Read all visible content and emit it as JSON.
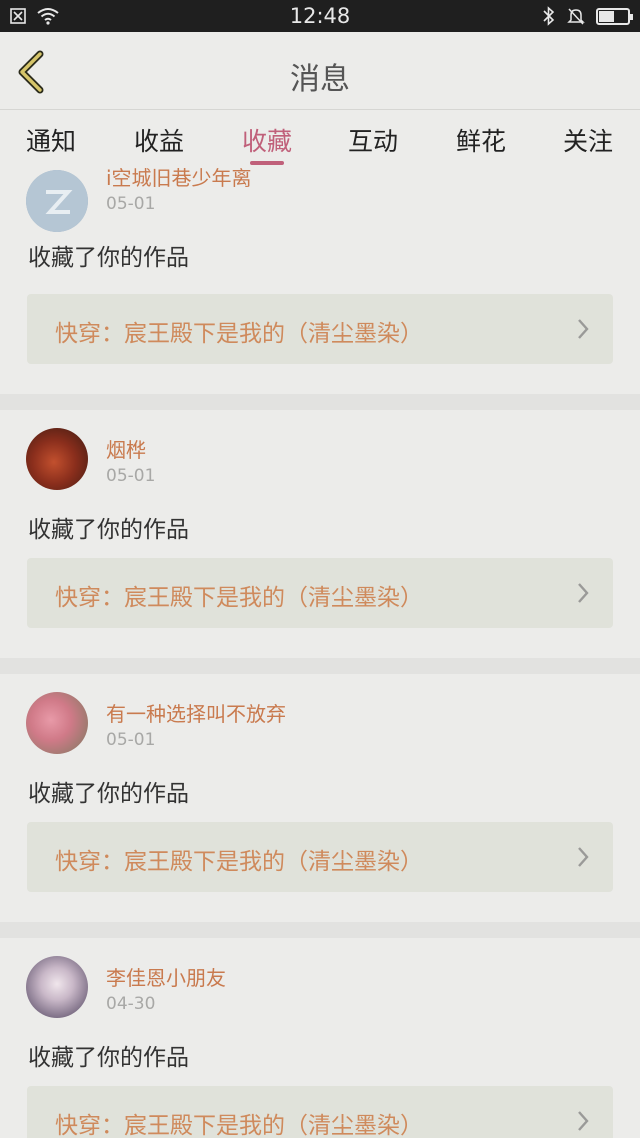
{
  "status_bar": {
    "time": "12:48",
    "battery_level": 0.55,
    "icons": [
      "notification-icon",
      "wifi-icon",
      "bluetooth-icon",
      "silent-bell-icon",
      "battery-icon"
    ]
  },
  "header": {
    "title": "消息"
  },
  "tabs": [
    {
      "label": "通知",
      "active": false
    },
    {
      "label": "收益",
      "active": false
    },
    {
      "label": "收藏",
      "active": true
    },
    {
      "label": "互动",
      "active": false
    },
    {
      "label": "鲜花",
      "active": false
    },
    {
      "label": "关注",
      "active": false
    }
  ],
  "items": [
    {
      "username": "i空城旧巷少年离",
      "date": "05-01",
      "action": "收藏了你的作品",
      "work_title": "快穿：宸王殿下是我的（清尘墨染）"
    },
    {
      "username": "烟桦",
      "date": "05-01",
      "action": "收藏了你的作品",
      "work_title": "快穿：宸王殿下是我的（清尘墨染）"
    },
    {
      "username": "有一种选择叫不放弃",
      "date": "05-01",
      "action": "收藏了你的作品",
      "work_title": "快穿：宸王殿下是我的（清尘墨染）"
    },
    {
      "username": "李佳恩小朋友",
      "date": "04-30",
      "action": "收藏了你的作品",
      "work_title": "快穿：宸王殿下是我的（清尘墨染）"
    }
  ],
  "colors": {
    "accent": "#c0607a",
    "username": "#c97a4e",
    "work_title": "#cf8a5c",
    "background": "#ececea"
  }
}
